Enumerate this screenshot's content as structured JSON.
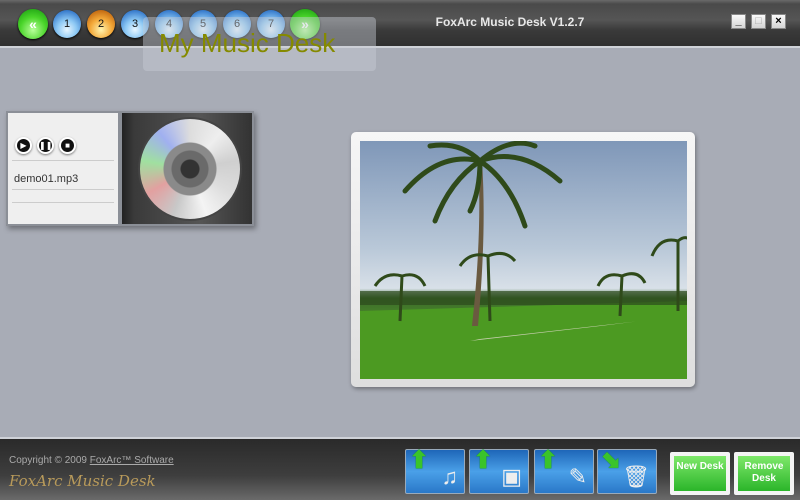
{
  "titlebar": {
    "title": "FoxArc Music Desk V1.2.7",
    "nav_prev": "«",
    "nav_next": "»",
    "pages": [
      "1",
      "2",
      "3",
      "4",
      "5",
      "6",
      "7"
    ],
    "active_page": "2",
    "minimize": "_",
    "maximize": "□",
    "close": "×"
  },
  "desk": {
    "label": "My Music Desk"
  },
  "music_player": {
    "file": "demo01.mp3",
    "play": "▶",
    "pause": "❚❚",
    "stop": "■"
  },
  "footer": {
    "copyright_prefix": "Copyright © 2009",
    "company": "FoxArc™ Software",
    "logo": "FoxArc Music Desk",
    "new_desk": "New Desk",
    "remove_desk": "Remove Desk"
  }
}
